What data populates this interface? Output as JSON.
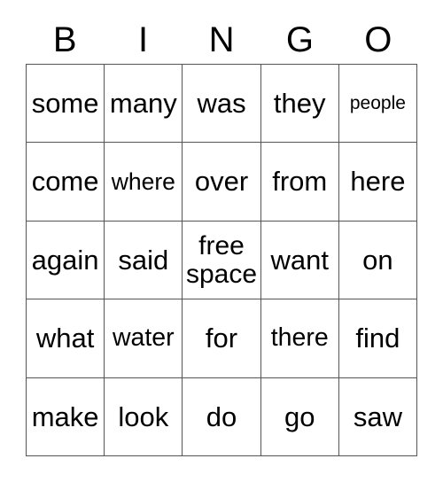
{
  "card": {
    "title": "BINGO",
    "header_letters": [
      "B",
      "I",
      "N",
      "G",
      "O"
    ],
    "border_color": "#555555",
    "text_color": "#000000",
    "background_color": "#ffffff",
    "rows": [
      [
        {
          "text": "some",
          "size": "normal"
        },
        {
          "text": "many",
          "size": "normal"
        },
        {
          "text": "was",
          "size": "normal"
        },
        {
          "text": "they",
          "size": "normal"
        },
        {
          "text": "people",
          "size": "xs"
        }
      ],
      [
        {
          "text": "come",
          "size": "normal"
        },
        {
          "text": "where",
          "size": "sm"
        },
        {
          "text": "over",
          "size": "normal"
        },
        {
          "text": "from",
          "size": "normal"
        },
        {
          "text": "here",
          "size": "normal"
        }
      ],
      [
        {
          "text": "again",
          "size": "normal"
        },
        {
          "text": "said",
          "size": "normal"
        },
        {
          "text": "free space",
          "size": "wrap"
        },
        {
          "text": "want",
          "size": "normal"
        },
        {
          "text": "on",
          "size": "normal"
        }
      ],
      [
        {
          "text": "what",
          "size": "normal"
        },
        {
          "text": "water",
          "size": "md"
        },
        {
          "text": "for",
          "size": "normal"
        },
        {
          "text": "there",
          "size": "md"
        },
        {
          "text": "find",
          "size": "normal"
        }
      ],
      [
        {
          "text": "make",
          "size": "normal"
        },
        {
          "text": "look",
          "size": "normal"
        },
        {
          "text": "do",
          "size": "normal"
        },
        {
          "text": "go",
          "size": "normal"
        },
        {
          "text": "saw",
          "size": "normal"
        }
      ]
    ]
  }
}
